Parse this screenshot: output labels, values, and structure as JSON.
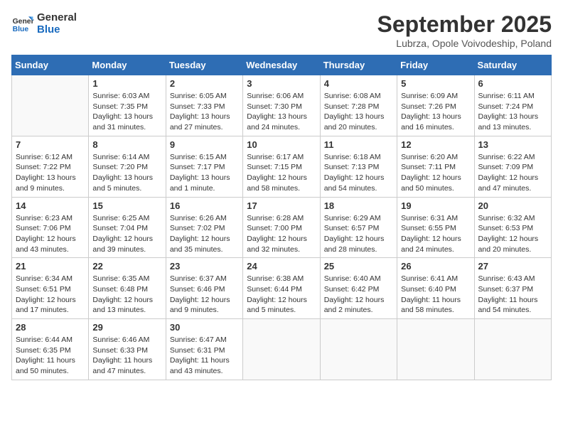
{
  "header": {
    "logo_line1": "General",
    "logo_line2": "Blue",
    "month": "September 2025",
    "location": "Lubrza, Opole Voivodeship, Poland"
  },
  "days_of_week": [
    "Sunday",
    "Monday",
    "Tuesday",
    "Wednesday",
    "Thursday",
    "Friday",
    "Saturday"
  ],
  "weeks": [
    [
      {
        "num": "",
        "info": ""
      },
      {
        "num": "1",
        "info": "Sunrise: 6:03 AM\nSunset: 7:35 PM\nDaylight: 13 hours\nand 31 minutes."
      },
      {
        "num": "2",
        "info": "Sunrise: 6:05 AM\nSunset: 7:33 PM\nDaylight: 13 hours\nand 27 minutes."
      },
      {
        "num": "3",
        "info": "Sunrise: 6:06 AM\nSunset: 7:30 PM\nDaylight: 13 hours\nand 24 minutes."
      },
      {
        "num": "4",
        "info": "Sunrise: 6:08 AM\nSunset: 7:28 PM\nDaylight: 13 hours\nand 20 minutes."
      },
      {
        "num": "5",
        "info": "Sunrise: 6:09 AM\nSunset: 7:26 PM\nDaylight: 13 hours\nand 16 minutes."
      },
      {
        "num": "6",
        "info": "Sunrise: 6:11 AM\nSunset: 7:24 PM\nDaylight: 13 hours\nand 13 minutes."
      }
    ],
    [
      {
        "num": "7",
        "info": "Sunrise: 6:12 AM\nSunset: 7:22 PM\nDaylight: 13 hours\nand 9 minutes."
      },
      {
        "num": "8",
        "info": "Sunrise: 6:14 AM\nSunset: 7:20 PM\nDaylight: 13 hours\nand 5 minutes."
      },
      {
        "num": "9",
        "info": "Sunrise: 6:15 AM\nSunset: 7:17 PM\nDaylight: 13 hours\nand 1 minute."
      },
      {
        "num": "10",
        "info": "Sunrise: 6:17 AM\nSunset: 7:15 PM\nDaylight: 12 hours\nand 58 minutes."
      },
      {
        "num": "11",
        "info": "Sunrise: 6:18 AM\nSunset: 7:13 PM\nDaylight: 12 hours\nand 54 minutes."
      },
      {
        "num": "12",
        "info": "Sunrise: 6:20 AM\nSunset: 7:11 PM\nDaylight: 12 hours\nand 50 minutes."
      },
      {
        "num": "13",
        "info": "Sunrise: 6:22 AM\nSunset: 7:09 PM\nDaylight: 12 hours\nand 47 minutes."
      }
    ],
    [
      {
        "num": "14",
        "info": "Sunrise: 6:23 AM\nSunset: 7:06 PM\nDaylight: 12 hours\nand 43 minutes."
      },
      {
        "num": "15",
        "info": "Sunrise: 6:25 AM\nSunset: 7:04 PM\nDaylight: 12 hours\nand 39 minutes."
      },
      {
        "num": "16",
        "info": "Sunrise: 6:26 AM\nSunset: 7:02 PM\nDaylight: 12 hours\nand 35 minutes."
      },
      {
        "num": "17",
        "info": "Sunrise: 6:28 AM\nSunset: 7:00 PM\nDaylight: 12 hours\nand 32 minutes."
      },
      {
        "num": "18",
        "info": "Sunrise: 6:29 AM\nSunset: 6:57 PM\nDaylight: 12 hours\nand 28 minutes."
      },
      {
        "num": "19",
        "info": "Sunrise: 6:31 AM\nSunset: 6:55 PM\nDaylight: 12 hours\nand 24 minutes."
      },
      {
        "num": "20",
        "info": "Sunrise: 6:32 AM\nSunset: 6:53 PM\nDaylight: 12 hours\nand 20 minutes."
      }
    ],
    [
      {
        "num": "21",
        "info": "Sunrise: 6:34 AM\nSunset: 6:51 PM\nDaylight: 12 hours\nand 17 minutes."
      },
      {
        "num": "22",
        "info": "Sunrise: 6:35 AM\nSunset: 6:48 PM\nDaylight: 12 hours\nand 13 minutes."
      },
      {
        "num": "23",
        "info": "Sunrise: 6:37 AM\nSunset: 6:46 PM\nDaylight: 12 hours\nand 9 minutes."
      },
      {
        "num": "24",
        "info": "Sunrise: 6:38 AM\nSunset: 6:44 PM\nDaylight: 12 hours\nand 5 minutes."
      },
      {
        "num": "25",
        "info": "Sunrise: 6:40 AM\nSunset: 6:42 PM\nDaylight: 12 hours\nand 2 minutes."
      },
      {
        "num": "26",
        "info": "Sunrise: 6:41 AM\nSunset: 6:40 PM\nDaylight: 11 hours\nand 58 minutes."
      },
      {
        "num": "27",
        "info": "Sunrise: 6:43 AM\nSunset: 6:37 PM\nDaylight: 11 hours\nand 54 minutes."
      }
    ],
    [
      {
        "num": "28",
        "info": "Sunrise: 6:44 AM\nSunset: 6:35 PM\nDaylight: 11 hours\nand 50 minutes."
      },
      {
        "num": "29",
        "info": "Sunrise: 6:46 AM\nSunset: 6:33 PM\nDaylight: 11 hours\nand 47 minutes."
      },
      {
        "num": "30",
        "info": "Sunrise: 6:47 AM\nSunset: 6:31 PM\nDaylight: 11 hours\nand 43 minutes."
      },
      {
        "num": "",
        "info": ""
      },
      {
        "num": "",
        "info": ""
      },
      {
        "num": "",
        "info": ""
      },
      {
        "num": "",
        "info": ""
      }
    ]
  ]
}
